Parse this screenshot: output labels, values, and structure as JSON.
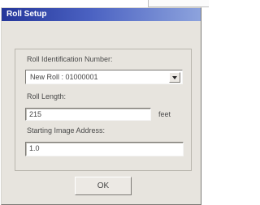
{
  "window": {
    "title": "Roll Setup"
  },
  "fields": {
    "roll_id_label": "Roll Identification Number:",
    "roll_id_value": "New Roll : 01000001",
    "roll_length_label": "Roll Length:",
    "roll_length_value": "215",
    "roll_length_unit": "feet",
    "start_address_label": "Starting Image Address:",
    "start_address_value": "1.0"
  },
  "buttons": {
    "ok_label": "OK"
  },
  "icons": {
    "dropdown": "chevron-down-icon"
  },
  "colors": {
    "titlebar_start": "#24369a",
    "titlebar_end": "#8da3dd",
    "dialog_background": "#e7e4de"
  }
}
